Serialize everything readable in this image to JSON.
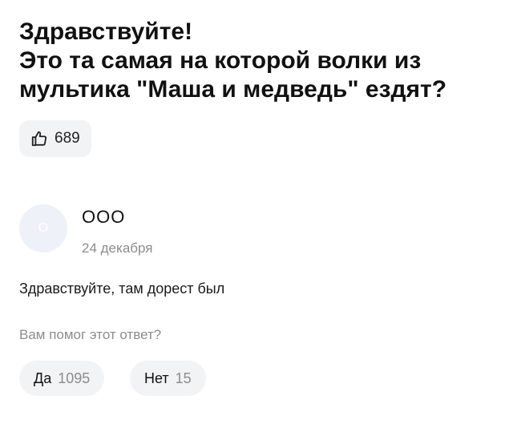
{
  "question": {
    "line1": "Здравствуйте!",
    "line2": "Это та самая на которой волки из",
    "line3": "мультика \"Маша и медведь\" ездят?"
  },
  "likes": {
    "count": "689",
    "icon": "thumbs-up-icon"
  },
  "answer": {
    "avatar_letter": "О",
    "author": "ООО",
    "date": "24 декабря",
    "text": "Здравствуйте, там дорест был"
  },
  "feedback": {
    "question": "Вам помог этот ответ?",
    "yes_label": "Да",
    "yes_count": "1095",
    "no_label": "Нет",
    "no_count": "15"
  },
  "colors": {
    "button_bg": "#f2f3f5",
    "muted_text": "#8c8c8c",
    "avatar_bg": "#eef1f8"
  }
}
